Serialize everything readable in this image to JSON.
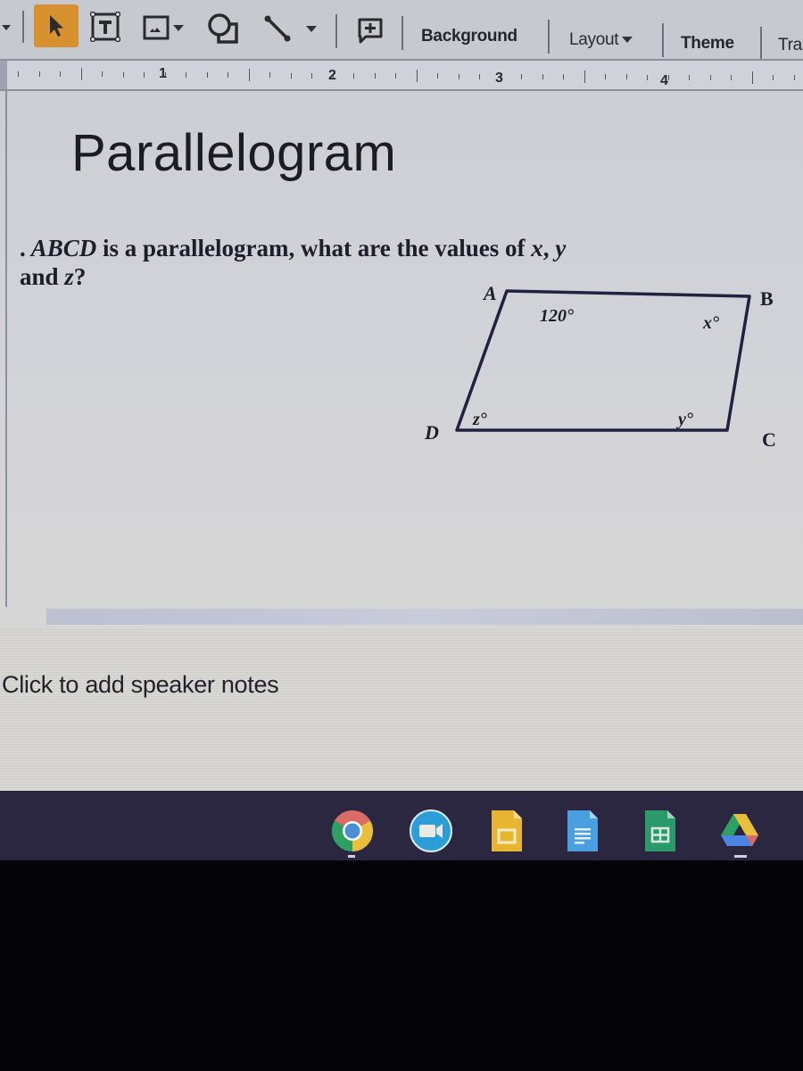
{
  "toolbar": {
    "tools": [
      {
        "name": "select",
        "icon": "cursor-arrow-icon",
        "active": true
      },
      {
        "name": "text-box",
        "icon": "text-box-icon"
      },
      {
        "name": "image",
        "icon": "image-icon",
        "has_dropdown": true
      },
      {
        "name": "shape",
        "icon": "shape-icon"
      },
      {
        "name": "line",
        "icon": "line-icon",
        "has_dropdown": true
      },
      {
        "name": "comment",
        "icon": "add-comment-icon"
      }
    ],
    "background_label": "Background",
    "layout_label": "Layout",
    "theme_label": "Theme",
    "transition_label": "Tra",
    "accent_color": "#d7922f"
  },
  "ruler": {
    "numbers": [
      "1",
      "2",
      "3",
      "4"
    ]
  },
  "slide": {
    "title": "Parallelogram",
    "question": {
      "lead": ".",
      "shape_name": "ABCD",
      "text": " is a parallelogram, what are the values of ",
      "var_x": "x",
      "sep1": ", ",
      "var_y": "y",
      "line2_prefix": "and ",
      "var_z": "z",
      "end": "?"
    },
    "diagram": {
      "vertices": {
        "A": "A",
        "B": "B",
        "C": "C",
        "D": "D"
      },
      "angle_A": "120°",
      "angle_B": "x°",
      "angle_C": "y°",
      "angle_D": "z°"
    }
  },
  "notes": {
    "placeholder": "Click to add speaker notes"
  },
  "shelf": {
    "apps": [
      {
        "name": "Chrome",
        "icon": "chrome-icon",
        "open": true
      },
      {
        "name": "Meet",
        "icon": "video-meet-icon",
        "open": false
      },
      {
        "name": "Slides",
        "icon": "slides-icon",
        "open": false
      },
      {
        "name": "Docs",
        "icon": "docs-icon",
        "open": false
      },
      {
        "name": "Sheets",
        "icon": "sheets-icon",
        "open": false
      },
      {
        "name": "Drive",
        "icon": "drive-icon",
        "open": true
      }
    ]
  }
}
